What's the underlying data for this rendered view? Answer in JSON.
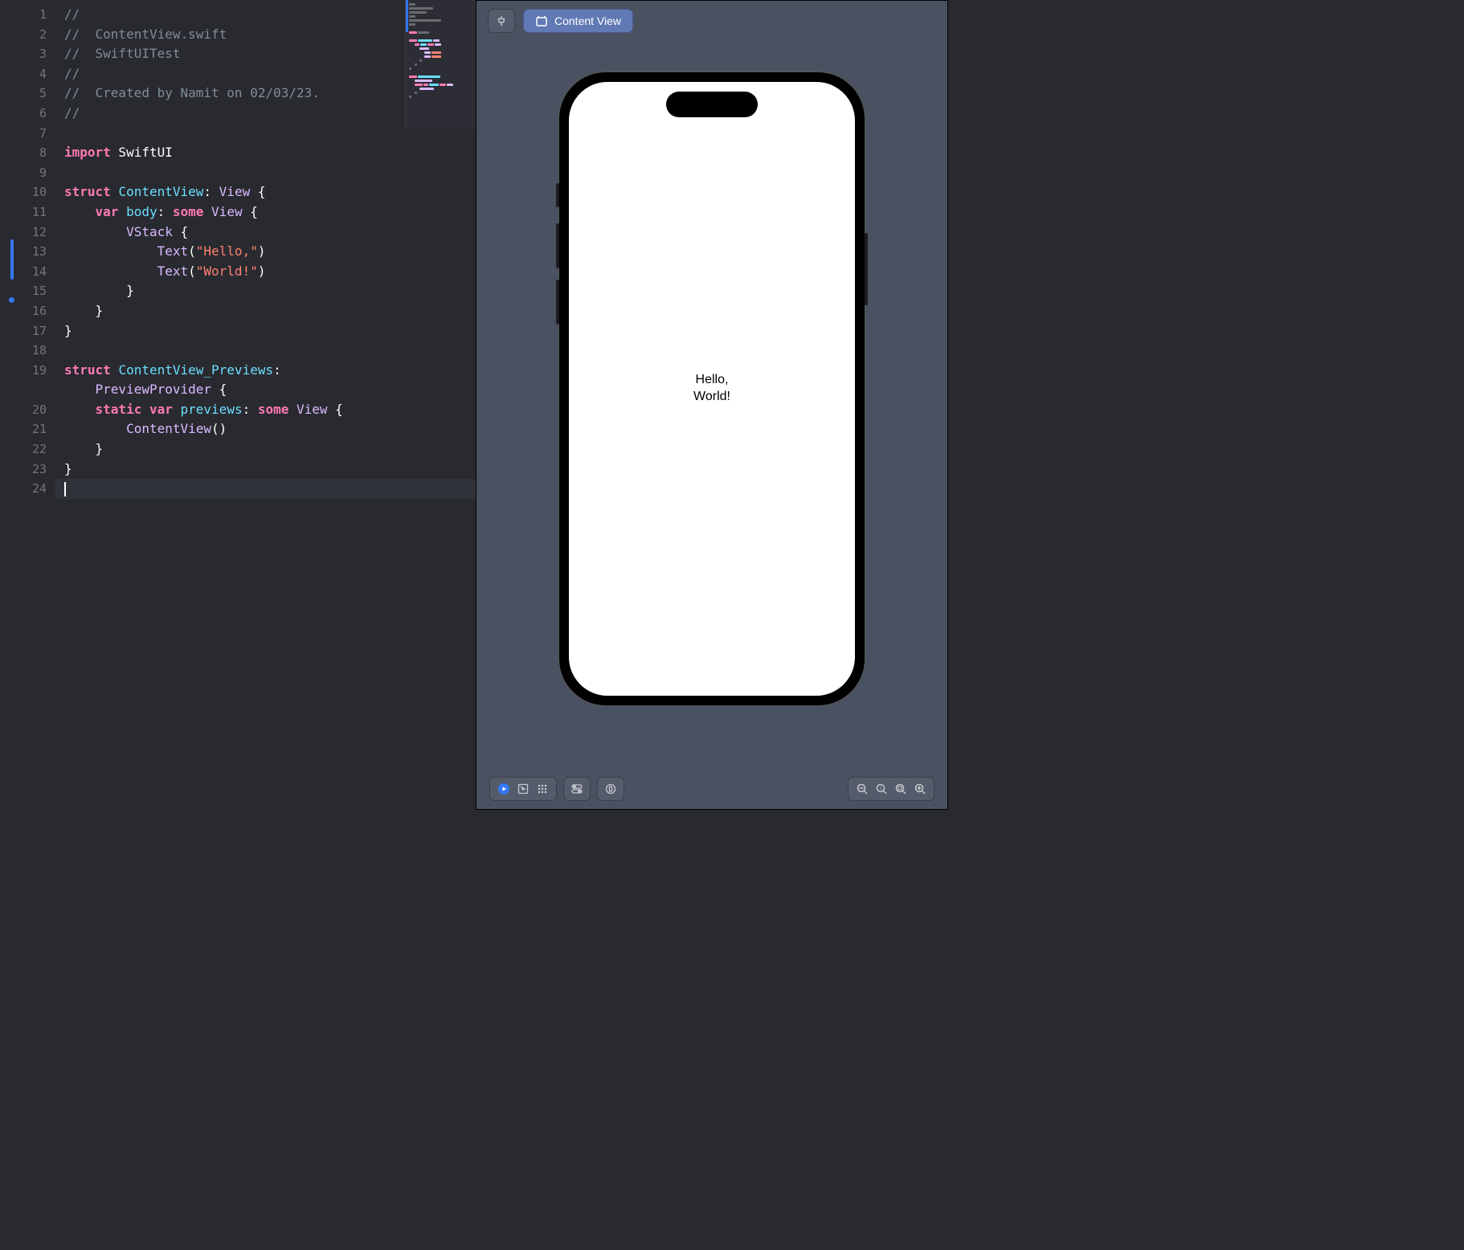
{
  "editor": {
    "lines": [
      {
        "num": "1",
        "segs": [
          {
            "t": "//",
            "c": "comment"
          }
        ]
      },
      {
        "num": "2",
        "segs": [
          {
            "t": "//  ContentView.swift",
            "c": "comment"
          }
        ]
      },
      {
        "num": "3",
        "segs": [
          {
            "t": "//  SwiftUITest",
            "c": "comment"
          }
        ]
      },
      {
        "num": "4",
        "segs": [
          {
            "t": "//",
            "c": "comment"
          }
        ]
      },
      {
        "num": "5",
        "segs": [
          {
            "t": "//  Created by Namit on 02/03/23.",
            "c": "comment"
          }
        ]
      },
      {
        "num": "6",
        "segs": [
          {
            "t": "//",
            "c": "comment"
          }
        ]
      },
      {
        "num": "7",
        "segs": []
      },
      {
        "num": "8",
        "segs": [
          {
            "t": "import",
            "c": "keyword-pink"
          },
          {
            "t": " SwiftUI",
            "c": "plain"
          }
        ]
      },
      {
        "num": "9",
        "segs": []
      },
      {
        "num": "10",
        "segs": [
          {
            "t": "struct",
            "c": "keyword-pink"
          },
          {
            "t": " ",
            "c": "plain"
          },
          {
            "t": "ContentView",
            "c": "type-turquoise"
          },
          {
            "t": ": ",
            "c": "plain"
          },
          {
            "t": "View",
            "c": "type-purple"
          },
          {
            "t": " {",
            "c": "plain"
          }
        ]
      },
      {
        "num": "11",
        "segs": [
          {
            "t": "    ",
            "c": "plain"
          },
          {
            "t": "var",
            "c": "keyword-pink"
          },
          {
            "t": " ",
            "c": "plain"
          },
          {
            "t": "body",
            "c": "type-turquoise"
          },
          {
            "t": ": ",
            "c": "plain"
          },
          {
            "t": "some",
            "c": "keyword-pink"
          },
          {
            "t": " ",
            "c": "plain"
          },
          {
            "t": "View",
            "c": "type-purple"
          },
          {
            "t": " {",
            "c": "plain"
          }
        ]
      },
      {
        "num": "12",
        "segs": [
          {
            "t": "        ",
            "c": "plain"
          },
          {
            "t": "VStack",
            "c": "type-purple"
          },
          {
            "t": " {",
            "c": "plain"
          }
        ]
      },
      {
        "num": "13",
        "segs": [
          {
            "t": "            ",
            "c": "plain"
          },
          {
            "t": "Text",
            "c": "type-purple"
          },
          {
            "t": "(",
            "c": "plain"
          },
          {
            "t": "\"Hello,\"",
            "c": "string-orange"
          },
          {
            "t": ")",
            "c": "plain"
          }
        ]
      },
      {
        "num": "14",
        "segs": [
          {
            "t": "            ",
            "c": "plain"
          },
          {
            "t": "Text",
            "c": "type-purple"
          },
          {
            "t": "(",
            "c": "plain"
          },
          {
            "t": "\"World!\"",
            "c": "string-orange"
          },
          {
            "t": ")",
            "c": "plain"
          }
        ]
      },
      {
        "num": "15",
        "segs": [
          {
            "t": "        }",
            "c": "plain"
          }
        ]
      },
      {
        "num": "16",
        "segs": [
          {
            "t": "    }",
            "c": "plain"
          }
        ]
      },
      {
        "num": "17",
        "segs": [
          {
            "t": "}",
            "c": "plain"
          }
        ]
      },
      {
        "num": "18",
        "segs": []
      },
      {
        "num": "19",
        "segs": [
          {
            "t": "struct",
            "c": "keyword-pink"
          },
          {
            "t": " ",
            "c": "plain"
          },
          {
            "t": "ContentView_Previews",
            "c": "type-turquoise"
          },
          {
            "t": ":",
            "c": "plain"
          }
        ]
      },
      {
        "num": "19b",
        "noNum": true,
        "segs": [
          {
            "t": "    ",
            "c": "plain"
          },
          {
            "t": "PreviewProvider",
            "c": "type-purple"
          },
          {
            "t": " {",
            "c": "plain"
          }
        ]
      },
      {
        "num": "20",
        "segs": [
          {
            "t": "    ",
            "c": "plain"
          },
          {
            "t": "static",
            "c": "keyword-pink"
          },
          {
            "t": " ",
            "c": "plain"
          },
          {
            "t": "var",
            "c": "keyword-pink"
          },
          {
            "t": " ",
            "c": "plain"
          },
          {
            "t": "previews",
            "c": "type-turquoise"
          },
          {
            "t": ": ",
            "c": "plain"
          },
          {
            "t": "some",
            "c": "keyword-pink"
          },
          {
            "t": " ",
            "c": "plain"
          },
          {
            "t": "View",
            "c": "type-purple"
          },
          {
            "t": " {",
            "c": "plain"
          }
        ]
      },
      {
        "num": "21",
        "segs": [
          {
            "t": "        ",
            "c": "plain"
          },
          {
            "t": "ContentView",
            "c": "type-purple"
          },
          {
            "t": "()",
            "c": "plain"
          }
        ]
      },
      {
        "num": "22",
        "segs": [
          {
            "t": "    }",
            "c": "plain"
          }
        ]
      },
      {
        "num": "23",
        "segs": [
          {
            "t": "}",
            "c": "plain"
          }
        ]
      },
      {
        "num": "24",
        "segs": [],
        "current": true
      }
    ]
  },
  "preview": {
    "toolbar": {
      "content_view_label": "Content View"
    },
    "screen": {
      "text_line1": "Hello,",
      "text_line2": "World!"
    }
  }
}
